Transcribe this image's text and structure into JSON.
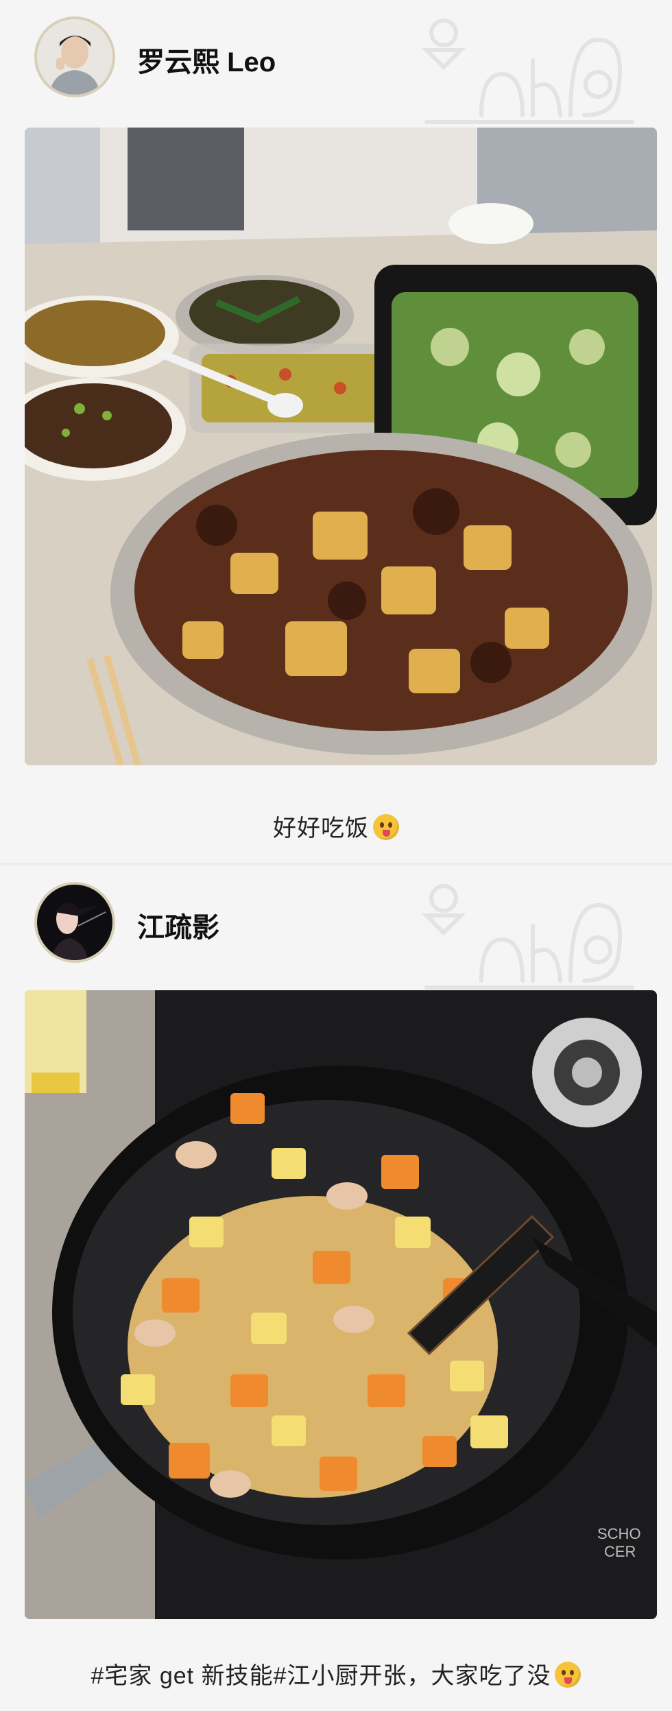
{
  "posts": [
    {
      "username": "罗云熙 Leo",
      "caption": "好好吃饭",
      "emoji": "tongue-out-emoji"
    },
    {
      "username": "江疏影",
      "caption": "#宅家 get 新技能#江小厨开张，大家吃了没",
      "emoji": "tongue-out-emoji"
    }
  ]
}
